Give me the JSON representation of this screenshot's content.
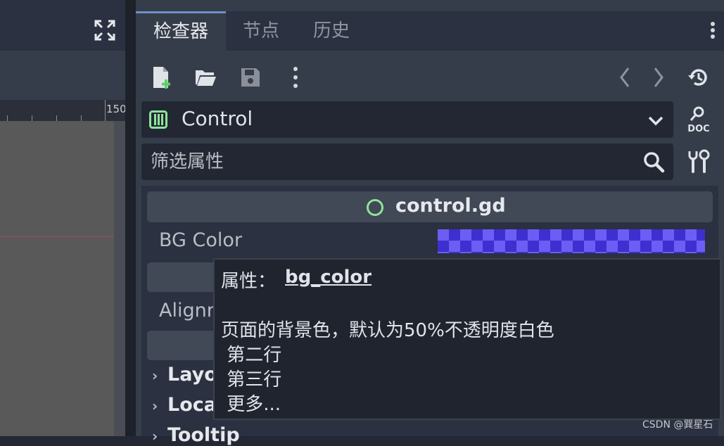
{
  "ruler": {
    "label": "150"
  },
  "dock": {
    "tabs": [
      {
        "label": "检查器"
      },
      {
        "label": "节点"
      },
      {
        "label": "历史"
      }
    ]
  },
  "inspector": {
    "class_name": "Control",
    "filter": {
      "placeholder": "筛选属性",
      "value": ""
    },
    "script": {
      "name": "control.gd"
    },
    "properties": {
      "bg_color_label": "BG Color",
      "bg_color_value": "#6c5ef5",
      "alignment_label": "Alignm"
    },
    "sections": [
      {
        "label": "Layo"
      },
      {
        "label": "Loca"
      },
      {
        "label": "Tooltip"
      }
    ]
  },
  "tooltip": {
    "prefix": "属性：",
    "property": "bg_color",
    "lines": [
      "页面的背景色，默认为50%不透明度白色",
      " 第二行",
      " 第三行",
      " 更多..."
    ]
  },
  "watermark": "CSDN @巽星石",
  "colors": {
    "accent": "#6c8fc9",
    "script_icon": "#8fe39b",
    "class_icon": "#8fe39b"
  }
}
